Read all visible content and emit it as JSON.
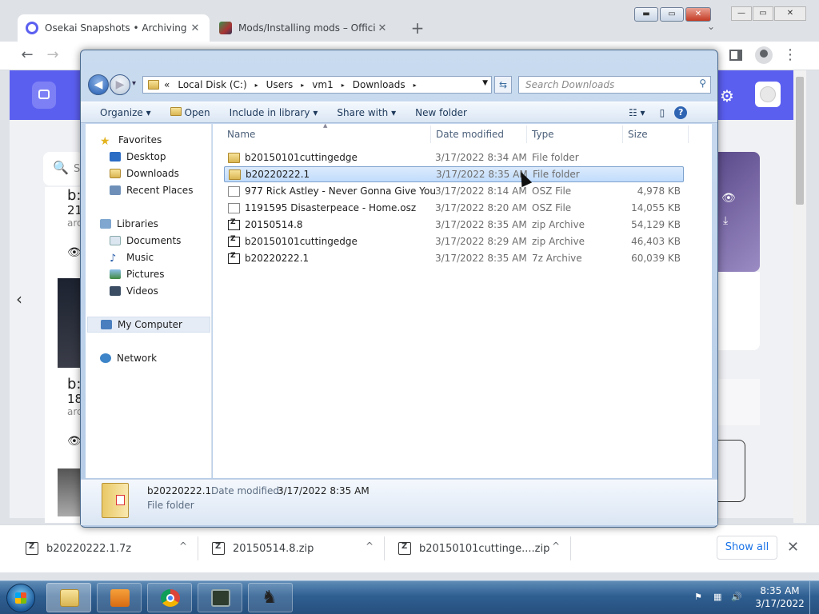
{
  "browser": {
    "tabs": [
      {
        "title": "Osekai Snapshots • Archiving osu",
        "close": "✕"
      },
      {
        "title": "Mods/Installing mods – Official M",
        "close": "✕"
      }
    ],
    "new_tab": "+",
    "tab_search": "⌄",
    "window_controls": {
      "minimize": "—",
      "maximize": "▭",
      "close": "✕"
    },
    "toolbar": {
      "back": "←",
      "forward": "→",
      "menu": "⋮"
    }
  },
  "page_fragments": {
    "search_letter": "S",
    "card1": {
      "title_prefix": "b:",
      "sub": "21",
      "meta": "arc"
    },
    "card2": {
      "title_prefix": "b:",
      "sub": "18",
      "meta": "arc"
    }
  },
  "explorer": {
    "window_controls": {
      "minimize": "▬",
      "maximize": "▭",
      "close": "✕"
    },
    "nav": {
      "back": "◀",
      "forward": "▶",
      "recent": "▾"
    },
    "address": {
      "overflow": "«",
      "crumbs": [
        "Local Disk (C:)",
        "Users",
        "vm1",
        "Downloads"
      ],
      "separator": "▸"
    },
    "search_placeholder": "Search Downloads",
    "commands": {
      "organize": "Organize",
      "open": "Open",
      "include": "Include in library",
      "share": "Share with",
      "new_folder": "New folder"
    },
    "navigation_pane": {
      "favorites": "Favorites",
      "favorites_items": [
        "Desktop",
        "Downloads",
        "Recent Places"
      ],
      "libraries": "Libraries",
      "libraries_items": [
        "Documents",
        "Music",
        "Pictures",
        "Videos"
      ],
      "computer": "My Computer",
      "network": "Network"
    },
    "columns": {
      "name": "Name",
      "date": "Date modified",
      "type": "Type",
      "size": "Size"
    },
    "files": [
      {
        "name": "b20150101cuttingedge",
        "date": "3/17/2022 8:34 AM",
        "type": "File folder",
        "size": "",
        "icon": "folder-icon"
      },
      {
        "name": "b20220222.1",
        "date": "3/17/2022 8:35 AM",
        "type": "File folder",
        "size": "",
        "icon": "folder-icon",
        "selected": true
      },
      {
        "name": "977 Rick Astley - Never Gonna Give You ...",
        "date": "3/17/2022 8:14 AM",
        "type": "OSZ File",
        "size": "4,978 KB",
        "icon": "file-icon"
      },
      {
        "name": "1191595 Disasterpeace - Home.osz",
        "date": "3/17/2022 8:20 AM",
        "type": "OSZ File",
        "size": "14,055 KB",
        "icon": "file-icon"
      },
      {
        "name": "20150514.8",
        "date": "3/17/2022 8:35 AM",
        "type": "zip Archive",
        "size": "54,129 KB",
        "icon": "archive-icon"
      },
      {
        "name": "b20150101cuttingedge",
        "date": "3/17/2022 8:29 AM",
        "type": "zip Archive",
        "size": "46,403 KB",
        "icon": "archive-icon"
      },
      {
        "name": "b20220222.1",
        "date": "3/17/2022 8:35 AM",
        "type": "7z Archive",
        "size": "60,039 KB",
        "icon": "archive-icon"
      }
    ],
    "details": {
      "name": "b20220222.1",
      "date_label": "Date modified:",
      "date": "3/17/2022 8:35 AM",
      "type": "File folder"
    }
  },
  "downloads": {
    "items": [
      "b20220222.1.7z",
      "20150514.8.zip",
      "b20150101cuttinge....zip"
    ],
    "chevron": "^",
    "show_all": "Show all",
    "close": "✕"
  },
  "taskbar": {
    "time": "8:35 AM",
    "date": "3/17/2022"
  },
  "colors": {
    "page_accent": "#5b5ff0",
    "selection": "#c1dcfc",
    "taskbar": "#2f5f92",
    "link": "#1a73e8"
  }
}
